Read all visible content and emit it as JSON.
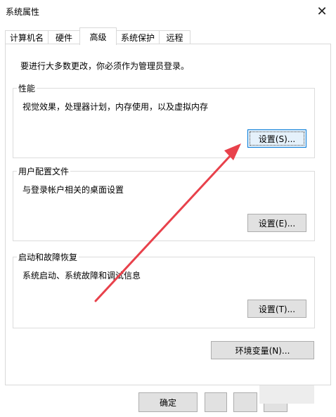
{
  "window": {
    "title": "系统属性",
    "close_symbol": "✕"
  },
  "tabs": [
    {
      "label": "计算机名",
      "active": false
    },
    {
      "label": "硬件",
      "active": false
    },
    {
      "label": "高级",
      "active": true
    },
    {
      "label": "系统保护",
      "active": false
    },
    {
      "label": "远程",
      "active": false
    }
  ],
  "advanced": {
    "intro": "要进行大多数更改，你必须作为管理员登录。",
    "performance": {
      "legend": "性能",
      "description": "视觉效果，处理器计划，内存使用，以及虚拟内存",
      "settings_label": "设置(S)..."
    },
    "user_profiles": {
      "legend": "用户配置文件",
      "description": "与登录帐户相关的桌面设置",
      "settings_label": "设置(E)..."
    },
    "startup_recovery": {
      "legend": "启动和故障恢复",
      "description": "系统启动、系统故障和调试信息",
      "settings_label": "设置(T)..."
    },
    "env_vars_label": "环境变量(N)..."
  },
  "footer": {
    "ok_label": "确定",
    "cancel_label": "",
    "apply_label": ""
  },
  "annotation": {
    "arrow_color": "#e8414b"
  }
}
